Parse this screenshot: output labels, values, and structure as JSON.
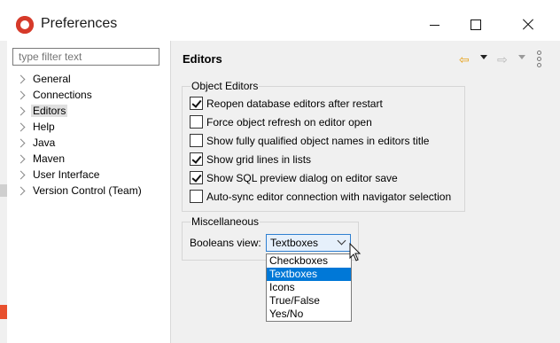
{
  "window": {
    "title": "Preferences"
  },
  "filter": {
    "placeholder": "type filter text"
  },
  "tree": {
    "items": [
      {
        "label": "General"
      },
      {
        "label": "Connections"
      },
      {
        "label": "Editors",
        "selected": true
      },
      {
        "label": "Help"
      },
      {
        "label": "Java"
      },
      {
        "label": "Maven"
      },
      {
        "label": "User Interface"
      },
      {
        "label": "Version Control (Team)"
      }
    ]
  },
  "page": {
    "title": "Editors"
  },
  "object_editors": {
    "legend": "Object Editors",
    "options": [
      {
        "label": "Reopen database editors after restart",
        "checked": true
      },
      {
        "label": "Force object refresh on editor open",
        "checked": false
      },
      {
        "label": "Show fully qualified object names in editors title",
        "checked": false
      },
      {
        "label": "Show grid lines in lists",
        "checked": true
      },
      {
        "label": "Show SQL preview dialog on editor save",
        "checked": true
      },
      {
        "label": "Auto-sync editor connection with navigator selection",
        "checked": false
      }
    ]
  },
  "misc": {
    "legend": "Miscellaneous",
    "booleans_label": "Booleans view:",
    "booleans_value": "Textboxes",
    "booleans_options": [
      "Checkboxes",
      "Textboxes",
      "Icons",
      "True/False",
      "Yes/No"
    ],
    "selected_option": "Textboxes"
  },
  "icons": {
    "app": "app-logo-icon",
    "back": "back-arrow-icon",
    "forward": "forward-arrow-icon",
    "menu": "more-options-icon"
  },
  "colors": {
    "accent": "#0078d7",
    "back_arrow": "#e7a21a"
  }
}
